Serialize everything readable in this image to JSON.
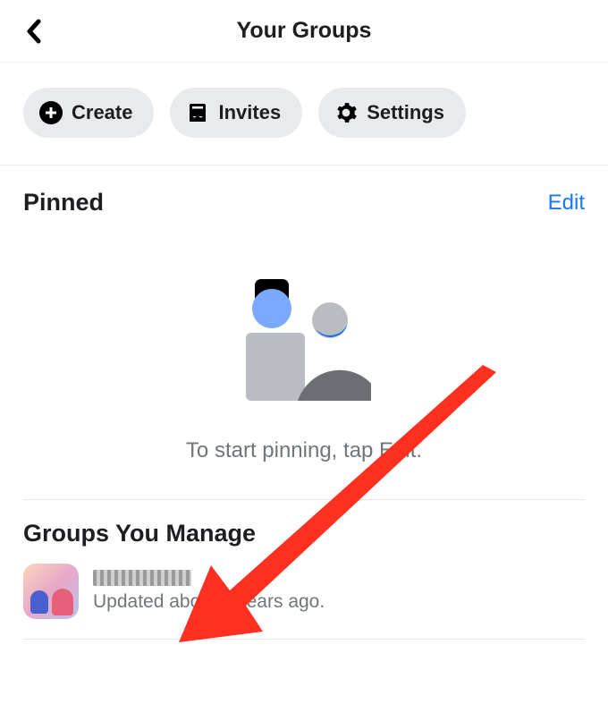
{
  "header": {
    "title": "Your Groups"
  },
  "actions": {
    "create": "Create",
    "invites": "Invites",
    "settings": "Settings"
  },
  "pinned": {
    "title": "Pinned",
    "edit": "Edit",
    "empty_text": "To start pinning, tap Edit."
  },
  "manage": {
    "title": "Groups You Manage",
    "items": [
      {
        "name": "",
        "subtitle": "Updated about 4 years ago."
      }
    ]
  }
}
